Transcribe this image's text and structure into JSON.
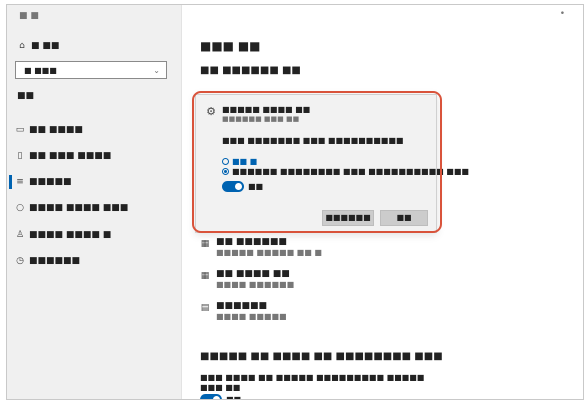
{
  "window": {
    "title": "■ ■",
    "title_dot": "•"
  },
  "sidebar": {
    "home_label": "■ ■■",
    "search": {
      "value": "■ ■■■",
      "placeholder": ""
    },
    "section_header": "■■",
    "items": [
      {
        "label": "■■ ■■■■",
        "icon": "laptop-icon"
      },
      {
        "label": "■■ ■■■ ■■■■",
        "icon": "phone-icon"
      },
      {
        "label": "■■■■■",
        "icon": "network-icon"
      },
      {
        "label": "■■■■ ■■■■ ■■■",
        "icon": "hand-icon"
      },
      {
        "label": "■■■■ ■■■■ ■",
        "icon": "person-icon"
      },
      {
        "label": "■■■■■■",
        "icon": "clock-icon"
      }
    ]
  },
  "main": {
    "page_title": "■■■ ■■",
    "subtitle": "■■ ■■■■■■ ■■",
    "list": [
      {
        "title": "■■ ■■■■■■",
        "sub": "■■■■■ ■■■■■ ■■ ■"
      },
      {
        "title": "■■ ■■■■ ■■",
        "sub": "■■■■ ■■■■■■"
      },
      {
        "title": "■■■■■■",
        "sub": "■■■■ ■■■■■"
      }
    ],
    "section2_title": "■■■■■ ■■ ■■■■ ■■ ■■■■■■■■ ■■■",
    "section2_desc": "■■■ ■■■■ ■■ ■■■■■ ■■■■■■■■■ ■■■■■",
    "section2_desc2": "■■■ ■■",
    "section2_toggle_label": "■■"
  },
  "popup": {
    "item_title": "■■■■■ ■■■■ ■■",
    "item_sub": "■■■■■■ ■■■ ■■",
    "question": "■■■ ■■■■■■■ ■■■ ■■■■■■■■■■",
    "option1": "■■ ■",
    "option2": "■■■■■■ ■■■■■■■■ ■■■ ■■■■■■■■■■ ■■■",
    "toggle_label": "■■",
    "cancel_label": "■■■■■■",
    "ok_label": "■■",
    "colors": {
      "accent": "#0063b1",
      "highlight": "#d9533b"
    }
  }
}
